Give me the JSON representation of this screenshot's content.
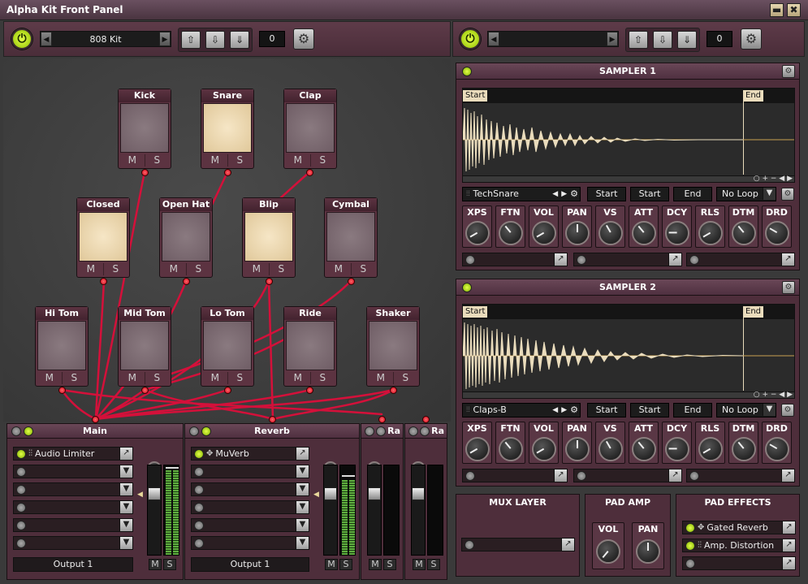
{
  "window": {
    "title": "Alpha Kit Front Panel",
    "minimize": "▬",
    "close": "✖"
  },
  "toolbar_left": {
    "kit_name": "808 Kit",
    "counter": "0"
  },
  "toolbar_right": {
    "kit_name": "",
    "counter": "0"
  },
  "pads": {
    "p0": {
      "name": "Kick",
      "m": "M",
      "s": "S"
    },
    "p1": {
      "name": "Snare",
      "m": "M",
      "s": "S"
    },
    "p2": {
      "name": "Clap",
      "m": "M",
      "s": "S"
    },
    "p3": {
      "name": "Closed Hat",
      "m": "M",
      "s": "S"
    },
    "p4": {
      "name": "Open Hat",
      "m": "M",
      "s": "S"
    },
    "p5": {
      "name": "Blip",
      "m": "M",
      "s": "S"
    },
    "p6": {
      "name": "Cymbal",
      "m": "M",
      "s": "S"
    },
    "p7": {
      "name": "Hi Tom",
      "m": "M",
      "s": "S"
    },
    "p8": {
      "name": "Mid Tom",
      "m": "M",
      "s": "S"
    },
    "p9": {
      "name": "Lo Tom",
      "m": "M",
      "s": "S"
    },
    "p10": {
      "name": "Ride",
      "m": "M",
      "s": "S"
    },
    "p11": {
      "name": "Shaker",
      "m": "M",
      "s": "S"
    }
  },
  "channels": {
    "main": {
      "name": "Main",
      "insert": "Audio Limiter",
      "output": "Output 1",
      "m": "M",
      "s": "S"
    },
    "reverb": {
      "name": "Reverb",
      "insert": "MuVerb",
      "output": "Output 1",
      "m": "M",
      "s": "S"
    },
    "ra1": {
      "name": "Ra",
      "m": "M",
      "s": "S"
    },
    "ra2": {
      "name": "Ra",
      "m": "M",
      "s": "S"
    }
  },
  "sampler1": {
    "title": "SAMPLER 1",
    "sample": "TechSnare",
    "start_label": "Start",
    "end_label": "End",
    "mode1": "Start",
    "mode2": "Start",
    "mode3": "End",
    "loop": "No Loop",
    "params": [
      "XPS",
      "FTN",
      "VOL",
      "PAN",
      "VS",
      "ATT",
      "DCY",
      "RLS",
      "DTM",
      "DRD"
    ]
  },
  "sampler2": {
    "title": "SAMPLER 2",
    "sample": "Claps-B",
    "start_label": "Start",
    "end_label": "End",
    "mode1": "Start",
    "mode2": "Start",
    "mode3": "End",
    "loop": "No Loop",
    "params": [
      "XPS",
      "FTN",
      "VOL",
      "PAN",
      "VS",
      "ATT",
      "DCY",
      "RLS",
      "DTM",
      "DRD"
    ]
  },
  "mux": {
    "title": "MUX LAYER"
  },
  "padamp": {
    "title": "PAD AMP",
    "vol": "VOL",
    "pan": "PAN"
  },
  "padfx": {
    "title": "PAD EFFECTS",
    "fx1": "Gated Reverb",
    "fx2": "Amp. Distortion"
  }
}
